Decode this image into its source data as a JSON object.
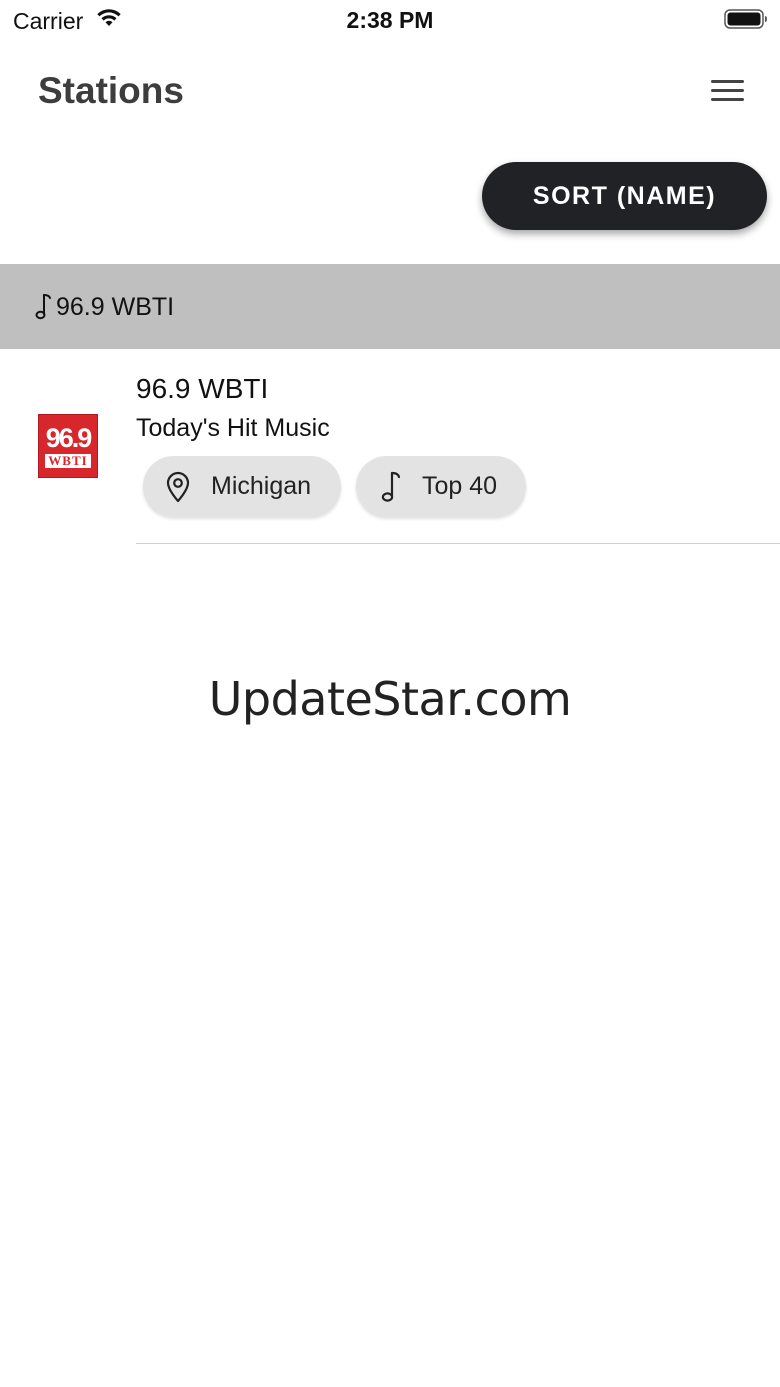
{
  "status_bar": {
    "carrier": "Carrier",
    "time": "2:38 PM"
  },
  "header": {
    "title": "Stations",
    "menu_icon": "hamburger-menu-icon"
  },
  "sort_button": {
    "label": "SORT (NAME)"
  },
  "section": {
    "icon": "music-note-icon",
    "title": "96.9 WBTI"
  },
  "stations": [
    {
      "name": "96.9 WBTI",
      "tagline": "Today's Hit Music",
      "logo": {
        "top_text": "96.9",
        "bottom_text": "WBTI",
        "color": "#d8262d"
      },
      "chips": {
        "location": {
          "icon": "location-pin-icon",
          "label": "Michigan"
        },
        "genre": {
          "icon": "music-note-icon",
          "label": "Top 40"
        }
      }
    }
  ],
  "watermark": "UpdateStar.com",
  "colors": {
    "sort_button_bg": "#202226",
    "section_header_bg": "#bfbfbf",
    "chip_bg": "#e3e3e3"
  }
}
